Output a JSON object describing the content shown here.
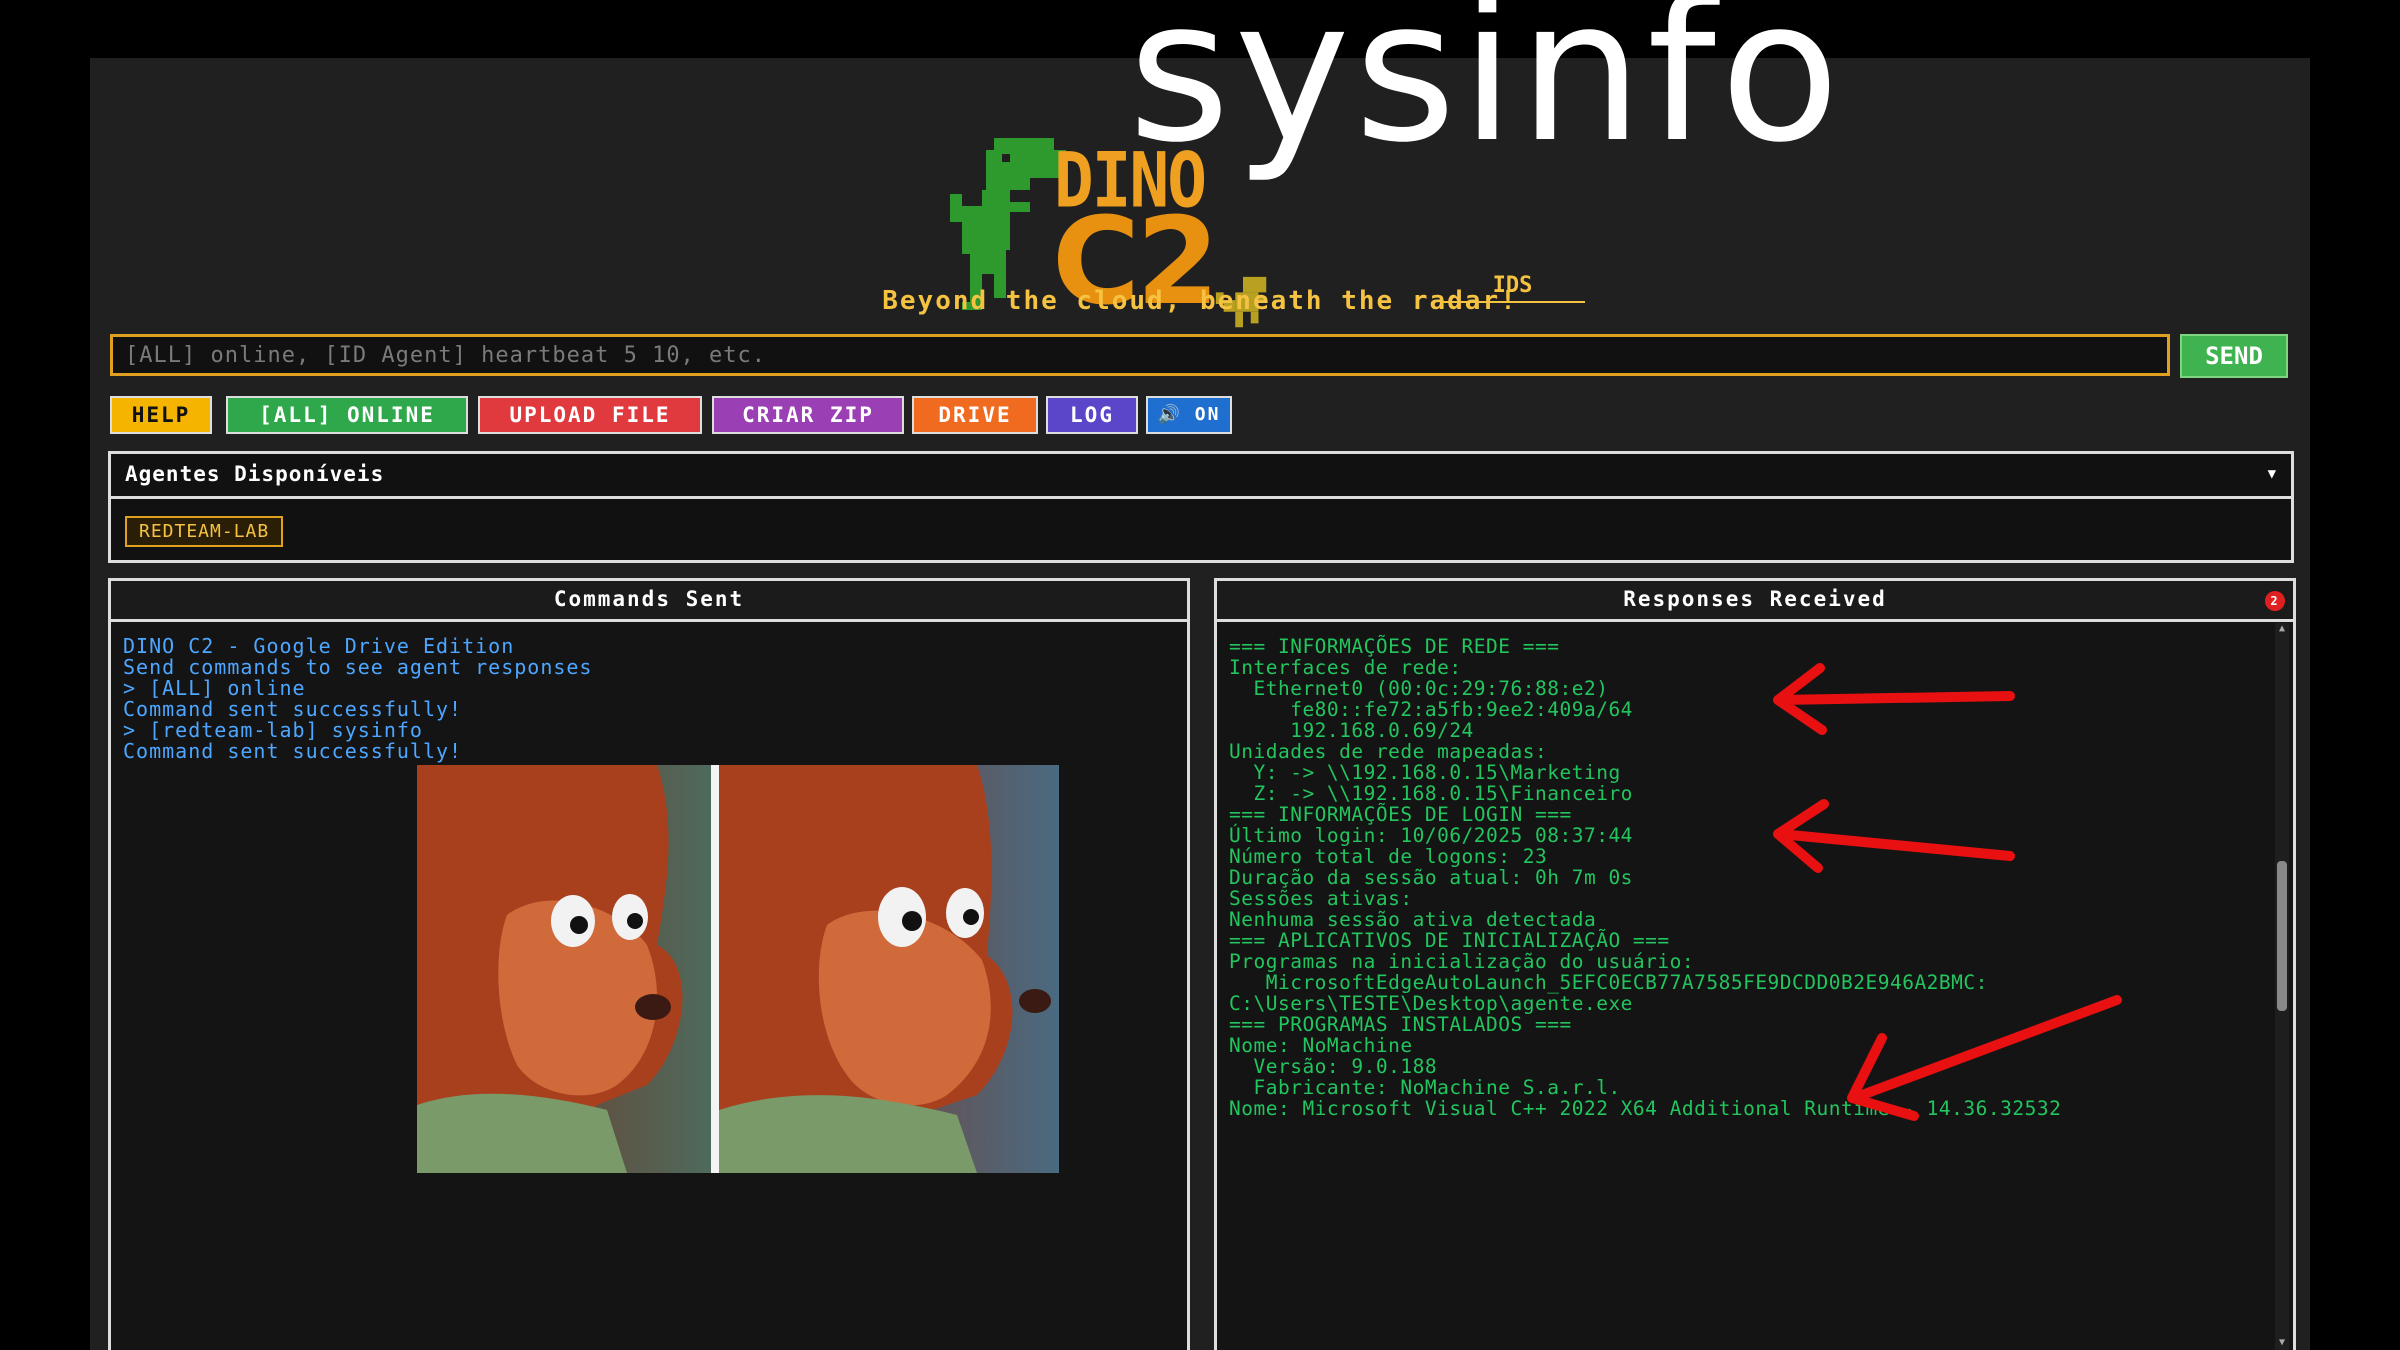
{
  "overlay_title": "sysinfo",
  "logo": {
    "line1": "DINO",
    "line2": "C2",
    "ids": "IDS"
  },
  "tagline": "Beyond the cloud, beneath the radar!",
  "command": {
    "placeholder": "[ALL] online, [ID Agent] heartbeat 5 10, etc.",
    "send_label": "SEND"
  },
  "quick_buttons": [
    {
      "label": "HELP",
      "color": "#f5b400",
      "text_color": "#111"
    },
    {
      "label": "[ALL] ONLINE",
      "color": "#2ea84a",
      "text_color": "#fff"
    },
    {
      "label": "UPLOAD FILE",
      "color": "#e0393e",
      "text_color": "#fff"
    },
    {
      "label": "CRIAR ZIP",
      "color": "#9b3fb5",
      "text_color": "#fff"
    },
    {
      "label": "DRIVE",
      "color": "#f06a20",
      "text_color": "#fff"
    },
    {
      "label": "LOG",
      "color": "#5b45c8",
      "text_color": "#fff"
    },
    {
      "label": "🔊 ON",
      "color": "#1f6fd0",
      "text_color": "#fff"
    }
  ],
  "agents": {
    "title": "Agentes Disponíveis",
    "caret": "▼",
    "items": [
      "REDTEAM-LAB"
    ]
  },
  "sent_panel": {
    "title": "Commands Sent",
    "lines": [
      "DINO C2 - Google Drive Edition",
      "Send commands to see agent responses",
      "> [ALL] online",
      "Command sent successfully!",
      "> [redteam-lab] sysinfo",
      "Command sent successfully!"
    ]
  },
  "responses_panel": {
    "title": "Responses Received",
    "badge": "2",
    "lines": [
      "=== INFORMAÇÕES DE REDE ===",
      "",
      "Interfaces de rede:",
      "  Ethernet0 (00:0c:29:76:88:e2)",
      "     fe80::fe72:a5fb:9ee2:409a/64",
      "     192.168.0.69/24",
      "",
      "Unidades de rede mapeadas:",
      "  Y: -> \\\\192.168.0.15\\Marketing",
      "  Z: -> \\\\192.168.0.15\\Financeiro",
      "",
      "=== INFORMAÇÕES DE LOGIN ===",
      "",
      "Último login: 10/06/2025 08:37:44",
      "Número total de logons: 23",
      "Duração da sessão atual: 0h 7m 0s",
      "",
      "Sessões ativas:",
      "Nenhuma sessão ativa detectada",
      "=== APLICATIVOS DE INICIALIZAÇÃO ===",
      "",
      "Programas na inicialização do usuário:",
      "   MicrosoftEdgeAutoLaunch_5EFC0ECB77A7585FE9DCDD0B2E946A2BMC:",
      "C:\\Users\\TESTE\\Desktop\\agente.exe",
      "",
      "=== PROGRAMAS INSTALADOS ===",
      "",
      "Nome: NoMachine",
      "  Versão: 9.0.188",
      "  Fabricante: NoMachine S.a.r.l.",
      "",
      "Nome: Microsoft Visual C++ 2022 X64 Additional Runtime - 14.36.32532"
    ]
  },
  "colors": {
    "accent": "#f5c242",
    "sent_text": "#4da6ff",
    "response_text": "#22c55e",
    "annotation_arrow": "#e81010"
  }
}
